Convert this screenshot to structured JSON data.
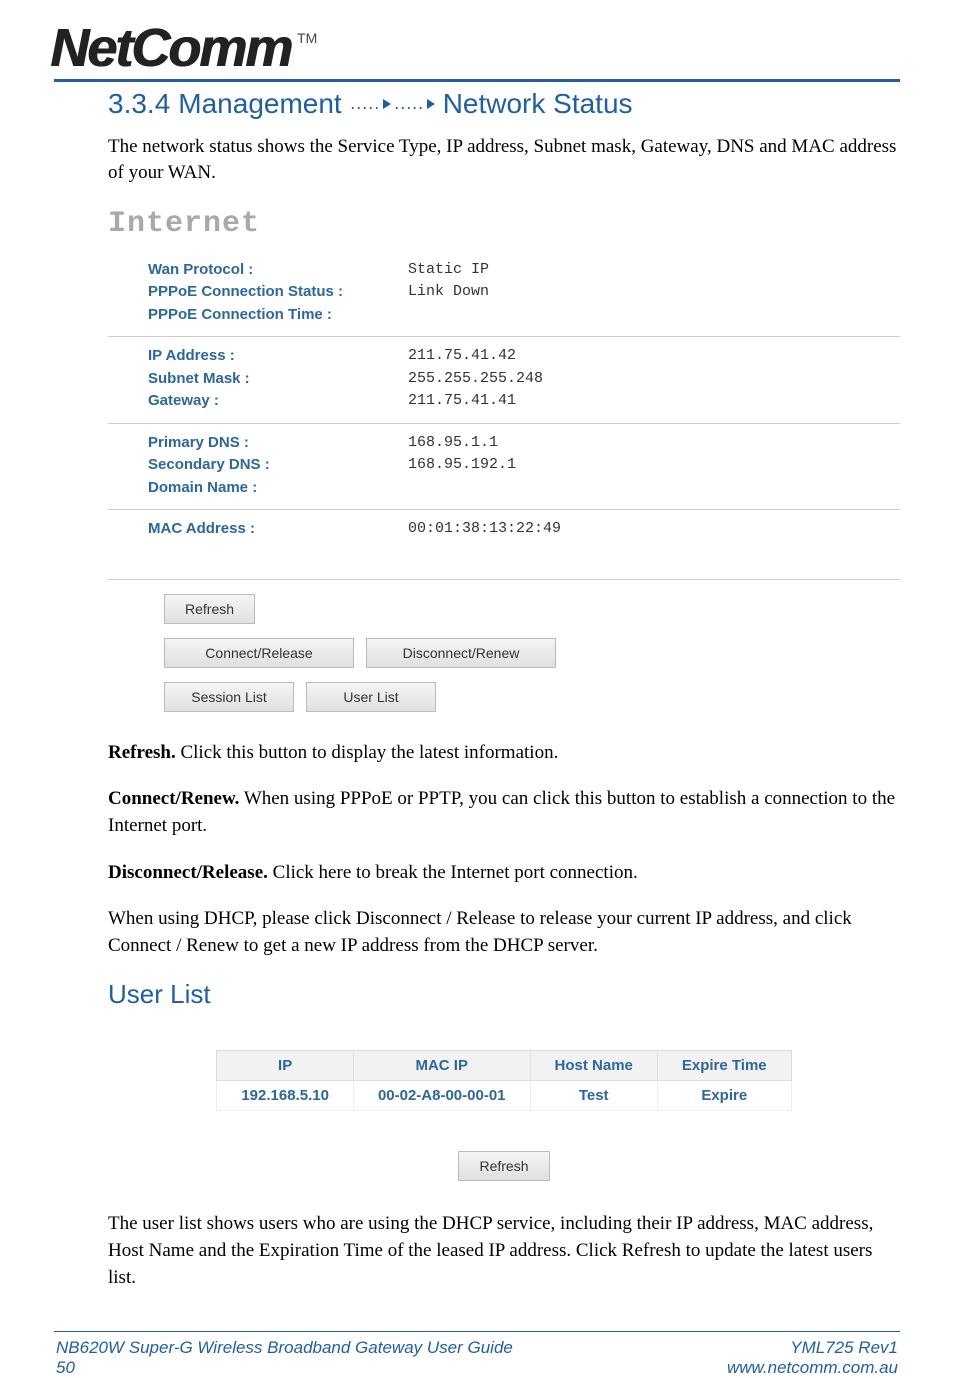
{
  "logo": {
    "text": "NetComm",
    "tm": "TM"
  },
  "section": {
    "number": "3.3.4",
    "title_left": "Management",
    "title_right": "Network Status"
  },
  "intro": "The network status shows the Service Type, IP address, Subnet mask, Gateway, DNS and MAC address of your WAN.",
  "panel": {
    "heading": "Internet",
    "block1": [
      {
        "label": "Wan Protocol :",
        "value": "Static IP"
      },
      {
        "label": "PPPoE Connection Status :",
        "value": "Link Down"
      },
      {
        "label": "PPPoE Connection Time :",
        "value": ""
      }
    ],
    "block2": [
      {
        "label": "IP Address :",
        "value": "211.75.41.42"
      },
      {
        "label": "Subnet Mask :",
        "value": "255.255.255.248"
      },
      {
        "label": "Gateway :",
        "value": "211.75.41.41"
      }
    ],
    "block3": [
      {
        "label": "Primary DNS :",
        "value": "168.95.1.1"
      },
      {
        "label": "Secondary DNS :",
        "value": "168.95.192.1"
      },
      {
        "label": "Domain Name :",
        "value": ""
      }
    ],
    "block4": [
      {
        "label": "MAC Address :",
        "value": "00:01:38:13:22:49"
      }
    ],
    "buttons": {
      "refresh": "Refresh",
      "connect_release": "Connect/Release",
      "disconnect_renew": "Disconnect/Renew",
      "session_list": "Session List",
      "user_list": "User List"
    }
  },
  "descriptions": {
    "refresh_bold": "Refresh.",
    "refresh_text": " Click this button to display the latest information.",
    "connect_bold": "Connect/Renew.",
    "connect_text": " When using PPPoE or PPTP, you can click this button to establish a connection to the Internet port.",
    "disconnect_bold": "Disconnect/Release.",
    "disconnect_text": " Click here to break the Internet port connection.",
    "dhcp_text": "When using DHCP, please click Disconnect / Release to release your current IP address, and click Connect / Renew to get a new IP address from the DHCP server."
  },
  "userlist": {
    "heading": "User List",
    "headers": [
      "IP",
      "MAC IP",
      "Host Name",
      "Expire Time"
    ],
    "row": [
      "192.168.5.10",
      "00-02-A8-00-00-01",
      "Test",
      "Expire"
    ],
    "refresh": "Refresh",
    "description": "The user list shows users who are using the DHCP service, including their IP address, MAC address, Host Name and the Expiration Time of the leased IP address. Click Refresh to update the latest users list."
  },
  "footer": {
    "left_line1": "NB620W Super-G Wireless Broadband  Gateway User Guide",
    "left_line2": "50",
    "right_line1": "YML725 Rev1",
    "right_line2": "www.netcomm.com.au"
  }
}
